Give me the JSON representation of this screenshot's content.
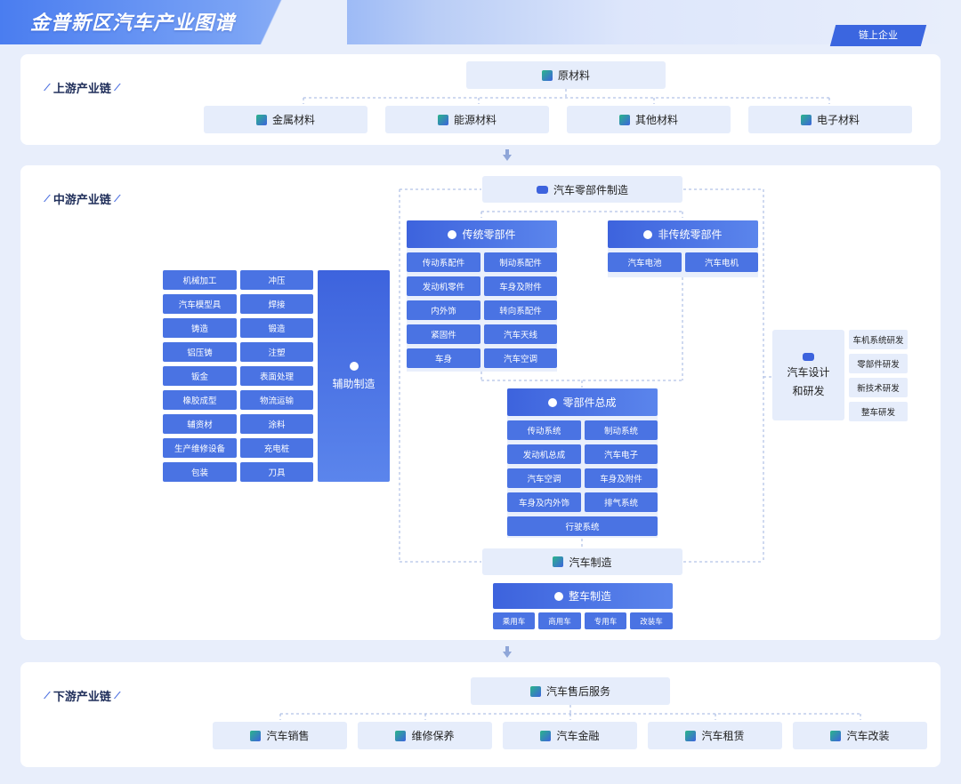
{
  "header": {
    "title": "金普新区汽车产业图谱",
    "button": "链上企业"
  },
  "upstream": {
    "label": "上游产业链",
    "root": "原材料",
    "items": [
      "金属材料",
      "能源材料",
      "其他材料",
      "电子材料"
    ]
  },
  "midstream": {
    "label": "中游产业链",
    "parts_mfg": "汽车零部件制造",
    "traditional": {
      "title": "传统零部件",
      "cells": [
        "传动系配件",
        "制动系配件",
        "发动机零件",
        "车身及附件",
        "内外饰",
        "转向系配件",
        "紧固件",
        "汽车天线",
        "车身",
        "汽车空调"
      ]
    },
    "nontraditional": {
      "title": "非传统零部件",
      "cells": [
        "汽车电池",
        "汽车电机"
      ]
    },
    "assembly": {
      "title": "零部件总成",
      "cells": [
        "传动系统",
        "制动系统",
        "发动机总成",
        "汽车电子",
        "汽车空调",
        "车身及附件",
        "车身及内外饰",
        "排气系统",
        "行驶系统"
      ]
    },
    "auxiliary": {
      "title": "辅助制造",
      "cells": [
        "机械加工",
        "冲压",
        "汽车模型具",
        "焊接",
        "铸造",
        "锻造",
        "铝压铸",
        "注塑",
        "钣金",
        "表面处理",
        "橡胶成型",
        "物流运输",
        "辅资材",
        "涂料",
        "生产维修设备",
        "充电桩",
        "包装",
        "刀具"
      ]
    },
    "design": {
      "title_line1": "汽车设计",
      "title_line2": "和研发",
      "cells": [
        "车机系统研发",
        "零部件研发",
        "新技术研发",
        "整车研发"
      ]
    },
    "vehicle_mfg": "汽车制造",
    "complete": {
      "title": "整车制造",
      "cells": [
        "乘用车",
        "商用车",
        "专用车",
        "改装车"
      ]
    }
  },
  "downstream": {
    "label": "下游产业链",
    "root": "汽车售后服务",
    "items": [
      "汽车销售",
      "维修保养",
      "汽车金融",
      "汽车租赁",
      "汽车改装"
    ]
  }
}
